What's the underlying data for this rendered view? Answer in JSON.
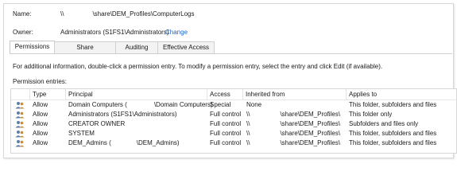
{
  "name_label": "Name:",
  "name_value_prefix": "\\\\",
  "name_value_suffix": "\\share\\DEM_Profiles\\ComputerLogs",
  "owner_label": "Owner:",
  "owner_value": "Administrators (S1FS1\\Administrators)",
  "change_link": "Change",
  "tabs": [
    {
      "label": "Permissions",
      "active": true
    },
    {
      "label": "Share",
      "active": false
    },
    {
      "label": "Auditing",
      "active": false
    },
    {
      "label": "Effective Access",
      "active": false
    }
  ],
  "info_text": "For additional information, double-click a permission entry. To modify a permission entry, select the entry and click Edit (if available).",
  "entries_label": "Permission entries:",
  "columns": [
    "Type",
    "Principal",
    "Access",
    "Inherited from",
    "Applies to"
  ],
  "rows": [
    {
      "type": "Allow",
      "principal_a": "Domain Computers (",
      "principal_b": "\\Domain Computers)",
      "access": "Special",
      "inh_a": "None",
      "inh_b": "",
      "applies": "This folder, subfolders and files"
    },
    {
      "type": "Allow",
      "principal_a": "Administrators (S1FS1\\Administrators)",
      "principal_b": "",
      "access": "Full control",
      "inh_a": "\\\\",
      "inh_b": "\\share\\DEM_Profiles\\",
      "applies": "This folder only"
    },
    {
      "type": "Allow",
      "principal_a": "CREATOR OWNER",
      "principal_b": "",
      "access": "Full control",
      "inh_a": "\\\\",
      "inh_b": "\\share\\DEM_Profiles\\",
      "applies": "Subfolders and files only"
    },
    {
      "type": "Allow",
      "principal_a": "SYSTEM",
      "principal_b": "",
      "access": "Full control",
      "inh_a": "\\\\",
      "inh_b": "\\share\\DEM_Profiles\\",
      "applies": "This folder, subfolders and files"
    },
    {
      "type": "Allow",
      "principal_a": "DEM_Admins (",
      "principal_b": "\\DEM_Admins)",
      "access": "Full control",
      "inh_a": "\\\\",
      "inh_b": "\\share\\DEM_Profiles\\",
      "applies": "This folder, subfolders and files"
    }
  ],
  "colors": {
    "link": "#1a66c9",
    "border": "#d6d6d6",
    "tab_inactive": "#f3f3f3"
  },
  "icons": [
    "user-group-icon"
  ]
}
